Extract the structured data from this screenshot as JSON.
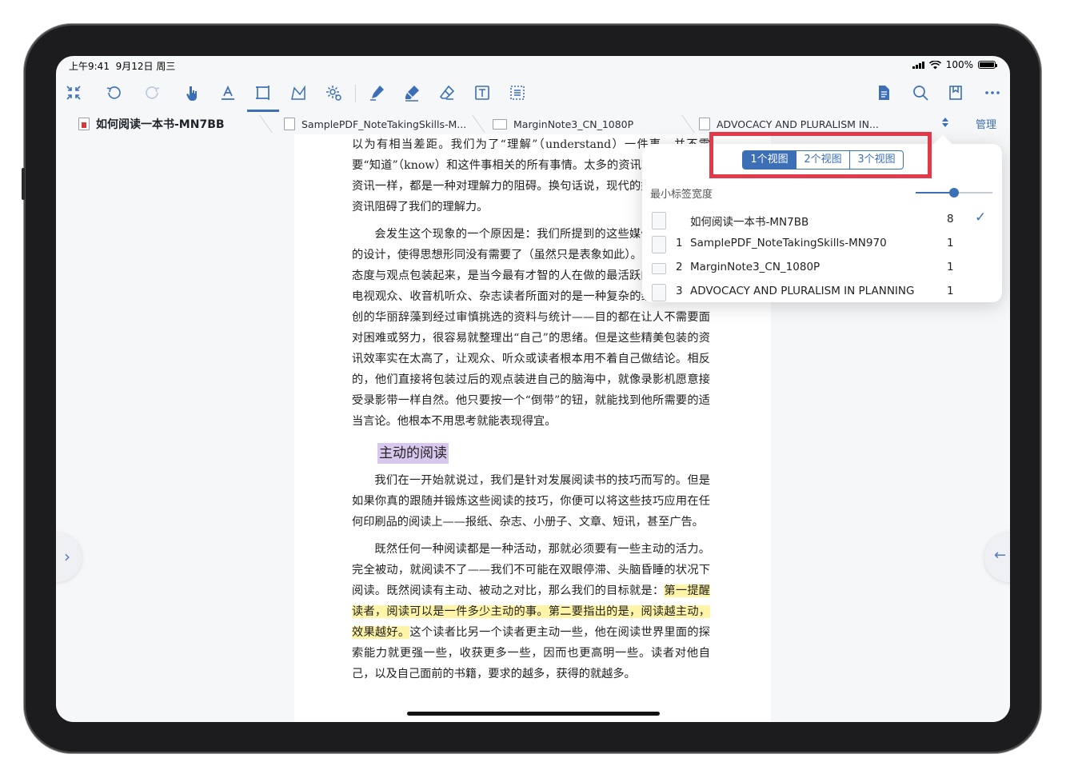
{
  "status": {
    "time": "上午9:41",
    "date": "9月12日 周三",
    "battery": "100%"
  },
  "toolbar": {
    "left_icons": [
      "collapse-icon",
      "undo-icon",
      "redo-icon",
      "hand-pointer-icon",
      "text-highlight-icon",
      "rect-select-icon",
      "lasso-icon",
      "settings-icon",
      "pen-icon",
      "highlighter-icon",
      "eraser-icon",
      "textbox-icon",
      "list-icon"
    ],
    "right_icons": [
      "document-icon",
      "search-icon",
      "bookmark-icon",
      "more-icon"
    ]
  },
  "tabs": [
    {
      "label": "如何阅读一本书-MN7BB",
      "active": true
    },
    {
      "label": "SamplePDF_NoteTakingSkills-M...",
      "active": false
    },
    {
      "label": "MarginNote3_CN_1080P",
      "active": false
    },
    {
      "label": "ADVOCACY AND PLURALISM IN...",
      "active": false
    }
  ],
  "manage_label": "管理",
  "popover": {
    "views": [
      "1个视图",
      "2个视图",
      "3个视图"
    ],
    "selected_view": "1个视图",
    "min_tab_width_label": "最小标签宽度",
    "slider_value": 0.5,
    "items": [
      {
        "num": "",
        "name": "如何阅读一本书-MN7BB",
        "count": "8",
        "checked": true
      },
      {
        "num": "1",
        "name": "SamplePDF_NoteTakingSkills-MN970",
        "count": "1",
        "checked": false
      },
      {
        "num": "2",
        "name": "MarginNote3_CN_1080P",
        "count": "1",
        "checked": false
      },
      {
        "num": "3",
        "name": "ADVOCACY AND PLURALISM IN PLANNING",
        "count": "1",
        "checked": false
      }
    ],
    "check_glyph": "✓"
  },
  "page": {
    "p1": "以为有相当差距。我们为了“理解”（understand）一件事，并不需要“知道”（know）和这件事相关的所有事情。太多的资讯就如同太少的资讯一样，都是一种对理解力的阻碍。换句话说，现代的媒体正以泛滥资讯阻碍了我们的理解力。",
    "p2": "会发生这个现象的一个原因是：我们所提到的这些媒体，经过精心的设计，使得思想形同没有需要了（虽然只是表象如此）。把知识分子的态度与观点包装起来，是当今最有才智的人在做的最活跃的事业之一。电视观众、收音机听众、杂志读者所面对的是一种复杂的组合——从独创的华丽辞藻到经过审慎挑选的资料与统计——目的都在让人不需要面对困难或努力，很容易就整理出“自己”的思绪。但是这些精美包装的资讯效率实在太高了，让观众、听众或读者根本用不着自己做结论。相反的，他们直接将包装过后的观点装进自己的脑海中，就像录影机愿意接受录影带一样自然。他只要按一个“倒带”的钮，就能找到他所需要的适当言论。他根本不用思考就能表现得宜。",
    "heading": "主动的阅读",
    "p3": "我们在一开始就说过，我们是针对发展阅读书的技巧而写的。但是如果你真的跟随并锻炼这些阅读的技巧，你便可以将这些技巧应用在任何印刷品的阅读上——报纸、杂志、小册子、文章、短讯，甚至广告。",
    "p4a": "既然任何一种阅读都是一种活动，那就必须要有一些主动的活力。完全被动，就阅读不了——我们不可能在双眼停滞、头脑昏睡的状况下阅读。既然阅读有主动、被动之对比，那么我们的目标就是：",
    "p4_highlight": "第一提醒读者，阅读可以是一件多少主动的事。第二要指出的是，阅读越主动，效果越好。",
    "p4b": "这个读者比另一个读者更主动一些，他在阅读世界里面的探索能力就更强一些，收获更多一些，因而也更高明一些。读者对他自己，以及自己面前的书籍，要求的越多，获得的就越多。"
  },
  "nav": {
    "left_arrow": "›",
    "right_arrow": "←"
  },
  "colors": {
    "accent": "#3c6fb6",
    "highlight_yellow": "#fff4a8",
    "highlight_purple": "#d9c8ee",
    "callout_red": "#e4394a"
  }
}
